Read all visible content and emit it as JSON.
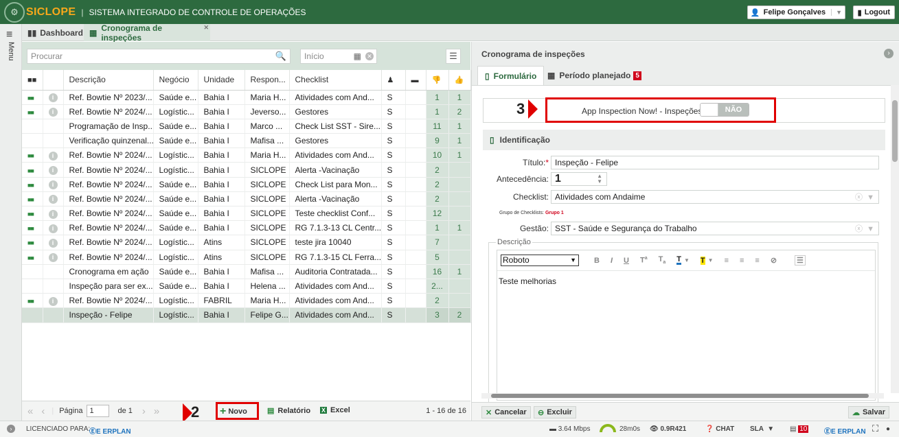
{
  "app": {
    "logo": "SICLOPE",
    "system_name": "SISTEMA INTEGRADO DE CONTROLE DE OPERAÇÕES",
    "user": "Felipe Gonçalves",
    "logout": "Logout"
  },
  "sidebar": {
    "menu_label": "Menu"
  },
  "tabs": [
    {
      "label": "Dashboard"
    },
    {
      "label": "Cronograma de inspeções"
    }
  ],
  "list": {
    "search_placeholder": "Procurar",
    "date_placeholder": "Início",
    "columns": [
      "Descrição",
      "Negócio",
      "Unidade",
      "Respon...",
      "Checklist"
    ],
    "rows": [
      {
        "icon": true,
        "desc": "Ref. Bowtie Nº 2023/...",
        "neg": "Saúde e...",
        "uni": "Bahia I",
        "resp": "Maria H...",
        "check": "Atividades com And...",
        "s": "S",
        "n1": "1",
        "n2": "1"
      },
      {
        "icon": true,
        "desc": "Ref. Bowtie Nº 2024/...",
        "neg": "Logístic...",
        "uni": "Bahia I",
        "resp": "Jeverso...",
        "check": "Gestores",
        "s": "S",
        "n1": "1",
        "n2": "2"
      },
      {
        "icon": false,
        "desc": "Programação de Insp...",
        "neg": "Saúde e...",
        "uni": "Bahia I",
        "resp": "Marco ...",
        "check": "Check List SST - Sire...",
        "s": "S",
        "n1": "11",
        "n2": "1"
      },
      {
        "icon": false,
        "desc": "Verificação quinzenal...",
        "neg": "Saúde e...",
        "uni": "Bahia I",
        "resp": "Mafisa ...",
        "check": "Gestores",
        "s": "S",
        "n1": "9",
        "n2": "1"
      },
      {
        "icon": true,
        "desc": "Ref. Bowtie Nº 2024/...",
        "neg": "Logístic...",
        "uni": "Bahia I",
        "resp": "Maria H...",
        "check": "Atividades com And...",
        "s": "S",
        "n1": "10",
        "n2": "1"
      },
      {
        "icon": true,
        "desc": "Ref. Bowtie Nº 2024/...",
        "neg": "Logístic...",
        "uni": "Bahia I",
        "resp": "SICLOPE",
        "check": "Alerta -Vacinação",
        "s": "S",
        "n1": "2",
        "n2": ""
      },
      {
        "icon": true,
        "desc": "Ref. Bowtie Nº 2024/...",
        "neg": "Saúde e...",
        "uni": "Bahia I",
        "resp": "SICLOPE",
        "check": "Check List para Mon...",
        "s": "S",
        "n1": "2",
        "n2": ""
      },
      {
        "icon": true,
        "desc": "Ref. Bowtie Nº 2024/...",
        "neg": "Saúde e...",
        "uni": "Bahia I",
        "resp": "SICLOPE",
        "check": "Alerta -Vacinação",
        "s": "S",
        "n1": "2",
        "n2": ""
      },
      {
        "icon": true,
        "desc": "Ref. Bowtie Nº 2024/...",
        "neg": "Saúde e...",
        "uni": "Bahia I",
        "resp": "SICLOPE",
        "check": "Teste checklist Conf...",
        "s": "S",
        "n1": "12",
        "n2": ""
      },
      {
        "icon": true,
        "desc": "Ref. Bowtie Nº 2024/...",
        "neg": "Saúde e...",
        "uni": "Bahia I",
        "resp": "SICLOPE",
        "check": "RG 7.1.3-13 CL Centr...",
        "s": "S",
        "n1": "1",
        "n2": "1"
      },
      {
        "icon": true,
        "desc": "Ref. Bowtie Nº 2024/...",
        "neg": "Logístic...",
        "uni": "Atins",
        "resp": "SICLOPE",
        "check": "teste jira 10040",
        "s": "S",
        "n1": "7",
        "n2": ""
      },
      {
        "icon": true,
        "desc": "Ref. Bowtie Nº 2024/...",
        "neg": "Logístic...",
        "uni": "Atins",
        "resp": "SICLOPE",
        "check": "RG 7.1.3-15 CL Ferra...",
        "s": "S",
        "n1": "5",
        "n2": ""
      },
      {
        "icon": false,
        "desc": "Cronograma em ação",
        "neg": "Saúde e...",
        "uni": "Bahia I",
        "resp": "Mafisa ...",
        "check": "Auditoria Contratada...",
        "s": "S",
        "n1": "16",
        "n2": "1"
      },
      {
        "icon": false,
        "desc": "Inspeção para ser ex...",
        "neg": "Saúde e...",
        "uni": "Bahia I",
        "resp": "Helena ...",
        "check": "Atividades com And...",
        "s": "S",
        "n1": "2...",
        "n2": ""
      },
      {
        "icon": true,
        "desc": "Ref. Bowtie Nº 2024/...",
        "neg": "Logístic...",
        "uni": "FABRIL",
        "resp": "Maria H...",
        "check": "Atividades com And...",
        "s": "S",
        "n1": "2",
        "n2": ""
      },
      {
        "icon": false,
        "desc": "Inspeção - Felipe",
        "neg": "Logístic...",
        "uni": "Bahia I",
        "resp": "Felipe G...",
        "check": "Atividades com And...",
        "s": "S",
        "n1": "3",
        "n2": "2",
        "selected": true
      }
    ],
    "footer": {
      "page_label": "Página",
      "page_value": "1",
      "of_label": "de 1",
      "new": "Novo",
      "report": "Relatório",
      "excel": "Excel",
      "range": "1 - 16 de 16"
    }
  },
  "annotations": {
    "step2": "2",
    "step3": "3"
  },
  "detail": {
    "title": "Cronograma de inspeções",
    "tabs": [
      {
        "label": "Formulário"
      },
      {
        "label": "Período planejado",
        "badge": "5"
      }
    ],
    "app_inspection_label": "App Inspection Now! - Inspeções",
    "app_inspection_value": "NÃO",
    "section": "Identificação",
    "fields": {
      "titulo_label": "Título:",
      "titulo_req": "*",
      "titulo_value": "Inspeção - Felipe",
      "antecedencia_label": "Antecedência:",
      "antecedencia_value": "1",
      "checklist_label": "Checklist:",
      "checklist_value": "Atividades com Andaime",
      "grupo_label": "Grupo de Checklists:",
      "grupo_value": "Grupo 1",
      "gestao_label": "Gestão:",
      "gestao_value": "SST - Saúde e Segurança do Trabalho",
      "descricao_label": "Descrição",
      "font": "Roboto",
      "descricao_value": "Teste melhorias"
    },
    "buttons": {
      "cancel": "Cancelar",
      "delete": "Excluir",
      "save": "Salvar"
    }
  },
  "status": {
    "licensed": "LICENCIADO PARA:",
    "brand": "ERPLAN",
    "speed": "3.64 Mbps",
    "time": "28m0s",
    "version": "0.9R421",
    "chat": "CHAT",
    "sla": "SLA",
    "notif": "10",
    "brand2": "ERPLAN"
  }
}
